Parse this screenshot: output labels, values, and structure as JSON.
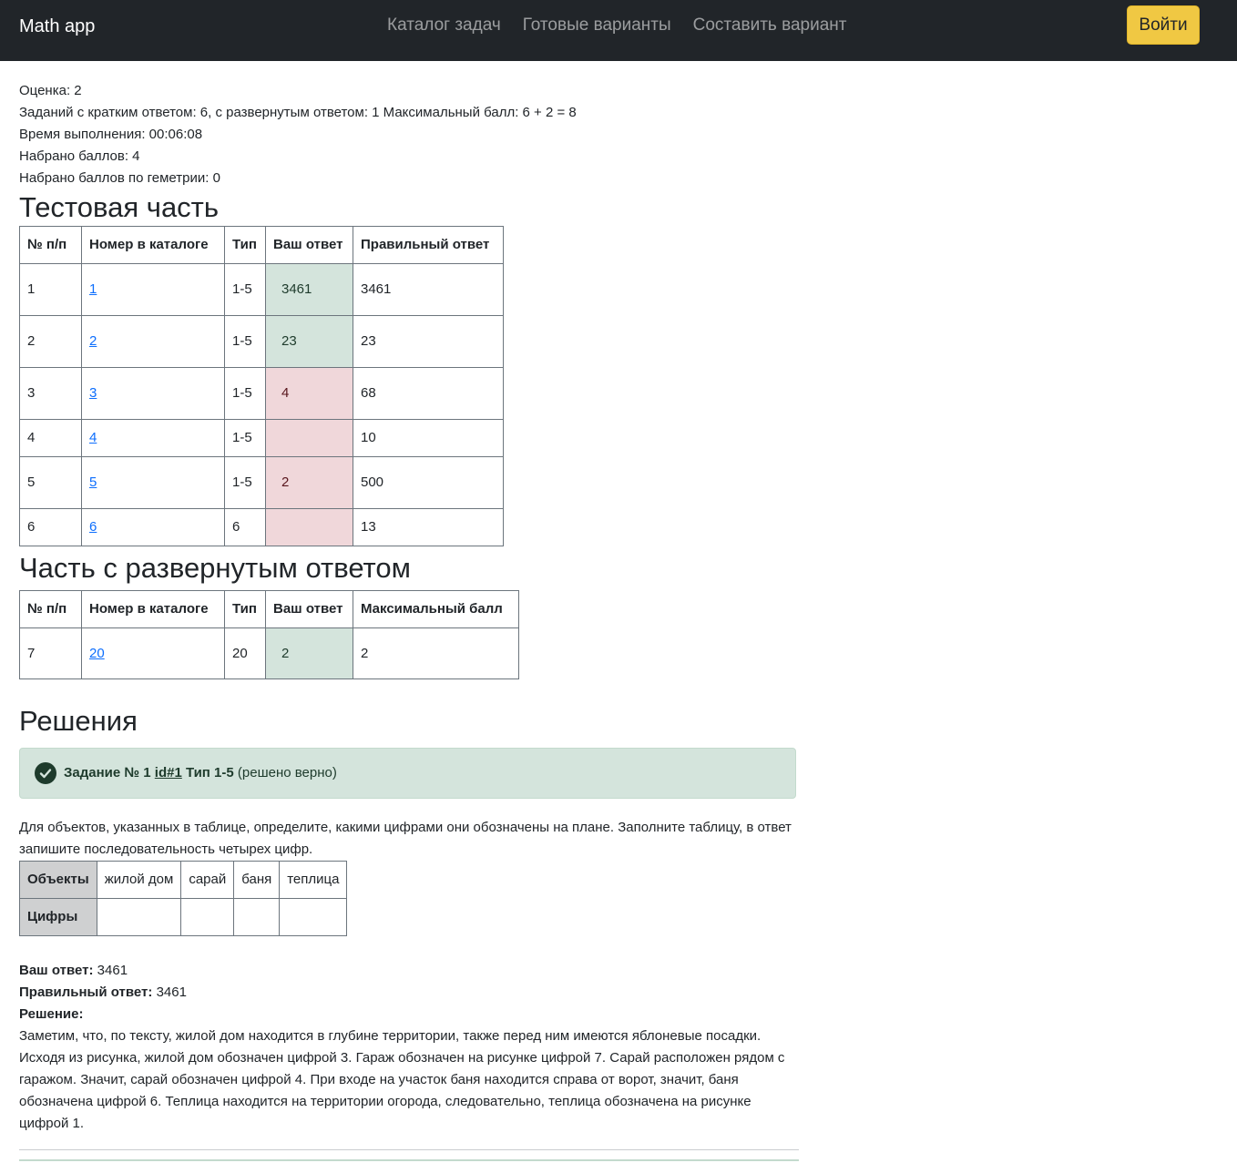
{
  "navbar": {
    "brand": "Math app",
    "links": [
      "Каталог задач",
      "Готовые варианты",
      "Составить вариант"
    ],
    "login": "Войти"
  },
  "summary": {
    "grade": "Оценка: 2",
    "tasks": "Заданий с кратким ответом: 6, с развернутым ответом: 1 Максимальный балл: 6 + 2 = 8",
    "time": "Время выполнения: 00:06:08",
    "score": "Набрано баллов: 4",
    "geometry": "Набрано баллов по геметрии: 0"
  },
  "test_part": {
    "title": "Тестовая часть",
    "headers": [
      "№ п/п",
      "Номер в каталоге",
      "Тип",
      "Ваш ответ",
      "Правильный ответ"
    ],
    "rows": [
      {
        "n": "1",
        "catalog": "1",
        "type": "1-5",
        "answer": "3461",
        "correct": "3461",
        "status": "ok"
      },
      {
        "n": "2",
        "catalog": "2",
        "type": "1-5",
        "answer": "23",
        "correct": "23",
        "status": "ok"
      },
      {
        "n": "3",
        "catalog": "3",
        "type": "1-5",
        "answer": "4",
        "correct": "68",
        "status": "bad"
      },
      {
        "n": "4",
        "catalog": "4",
        "type": "1-5",
        "answer": "",
        "correct": "10",
        "status": "bad"
      },
      {
        "n": "5",
        "catalog": "5",
        "type": "1-5",
        "answer": "2",
        "correct": "500",
        "status": "bad"
      },
      {
        "n": "6",
        "catalog": "6",
        "type": "6",
        "answer": "",
        "correct": "13",
        "status": "bad"
      }
    ]
  },
  "extended_part": {
    "title": "Часть с развернутым ответом",
    "headers": [
      "№ п/п",
      "Номер в каталоге",
      "Тип",
      "Ваш ответ",
      "Максимальный балл"
    ],
    "rows": [
      {
        "n": "7",
        "catalog": "20",
        "type": "20",
        "answer": "2",
        "max": "2",
        "status": "ok"
      }
    ]
  },
  "solutions": {
    "title": "Решения",
    "task": {
      "label": "Задание № 1",
      "id_link": "id#1",
      "type": "Тип 1-5",
      "status": "(решено верно)",
      "text": "Для объектов, указанных в таблице, определите, какими цифрами они обозначены на плане. Заполните таблицу, в ответ запишите последовательность четырех цифр.",
      "objects_header": "Объекты",
      "objects": [
        "жилой дом",
        "сарай",
        "баня",
        "теплица"
      ],
      "digits_header": "Цифры",
      "your_answer_label": "Ваш ответ:",
      "your_answer": "3461",
      "correct_answer_label": "Правильный ответ:",
      "correct_answer": "3461",
      "solution_label": "Решение:",
      "solution_text": "Заметим, что, по тексту, жилой дом находится в глубине территории, также перед ним имеются яблоневые посадки. Исходя из рисунка, жилой дом обозначен цифрой 3. Гараж обозначен на рисунке цифрой 7. Сарай расположен рядом с гаражом. Значит, сарай обозначен цифрой 4. При входе на участок баня находится справа от ворот, значит, баня обозначена цифрой 6. Теплица находится на территории огорода, следовательно, теплица обозначена на рисунке цифрой 1."
    }
  },
  "colors": {
    "navbar": "#212529",
    "login_button": "#f0c843",
    "correct_cell": "#d4e4dc",
    "wrong_cell": "#f0d7da",
    "link": "#0d6efd"
  },
  "icons": {
    "status": "check-circle-icon"
  }
}
